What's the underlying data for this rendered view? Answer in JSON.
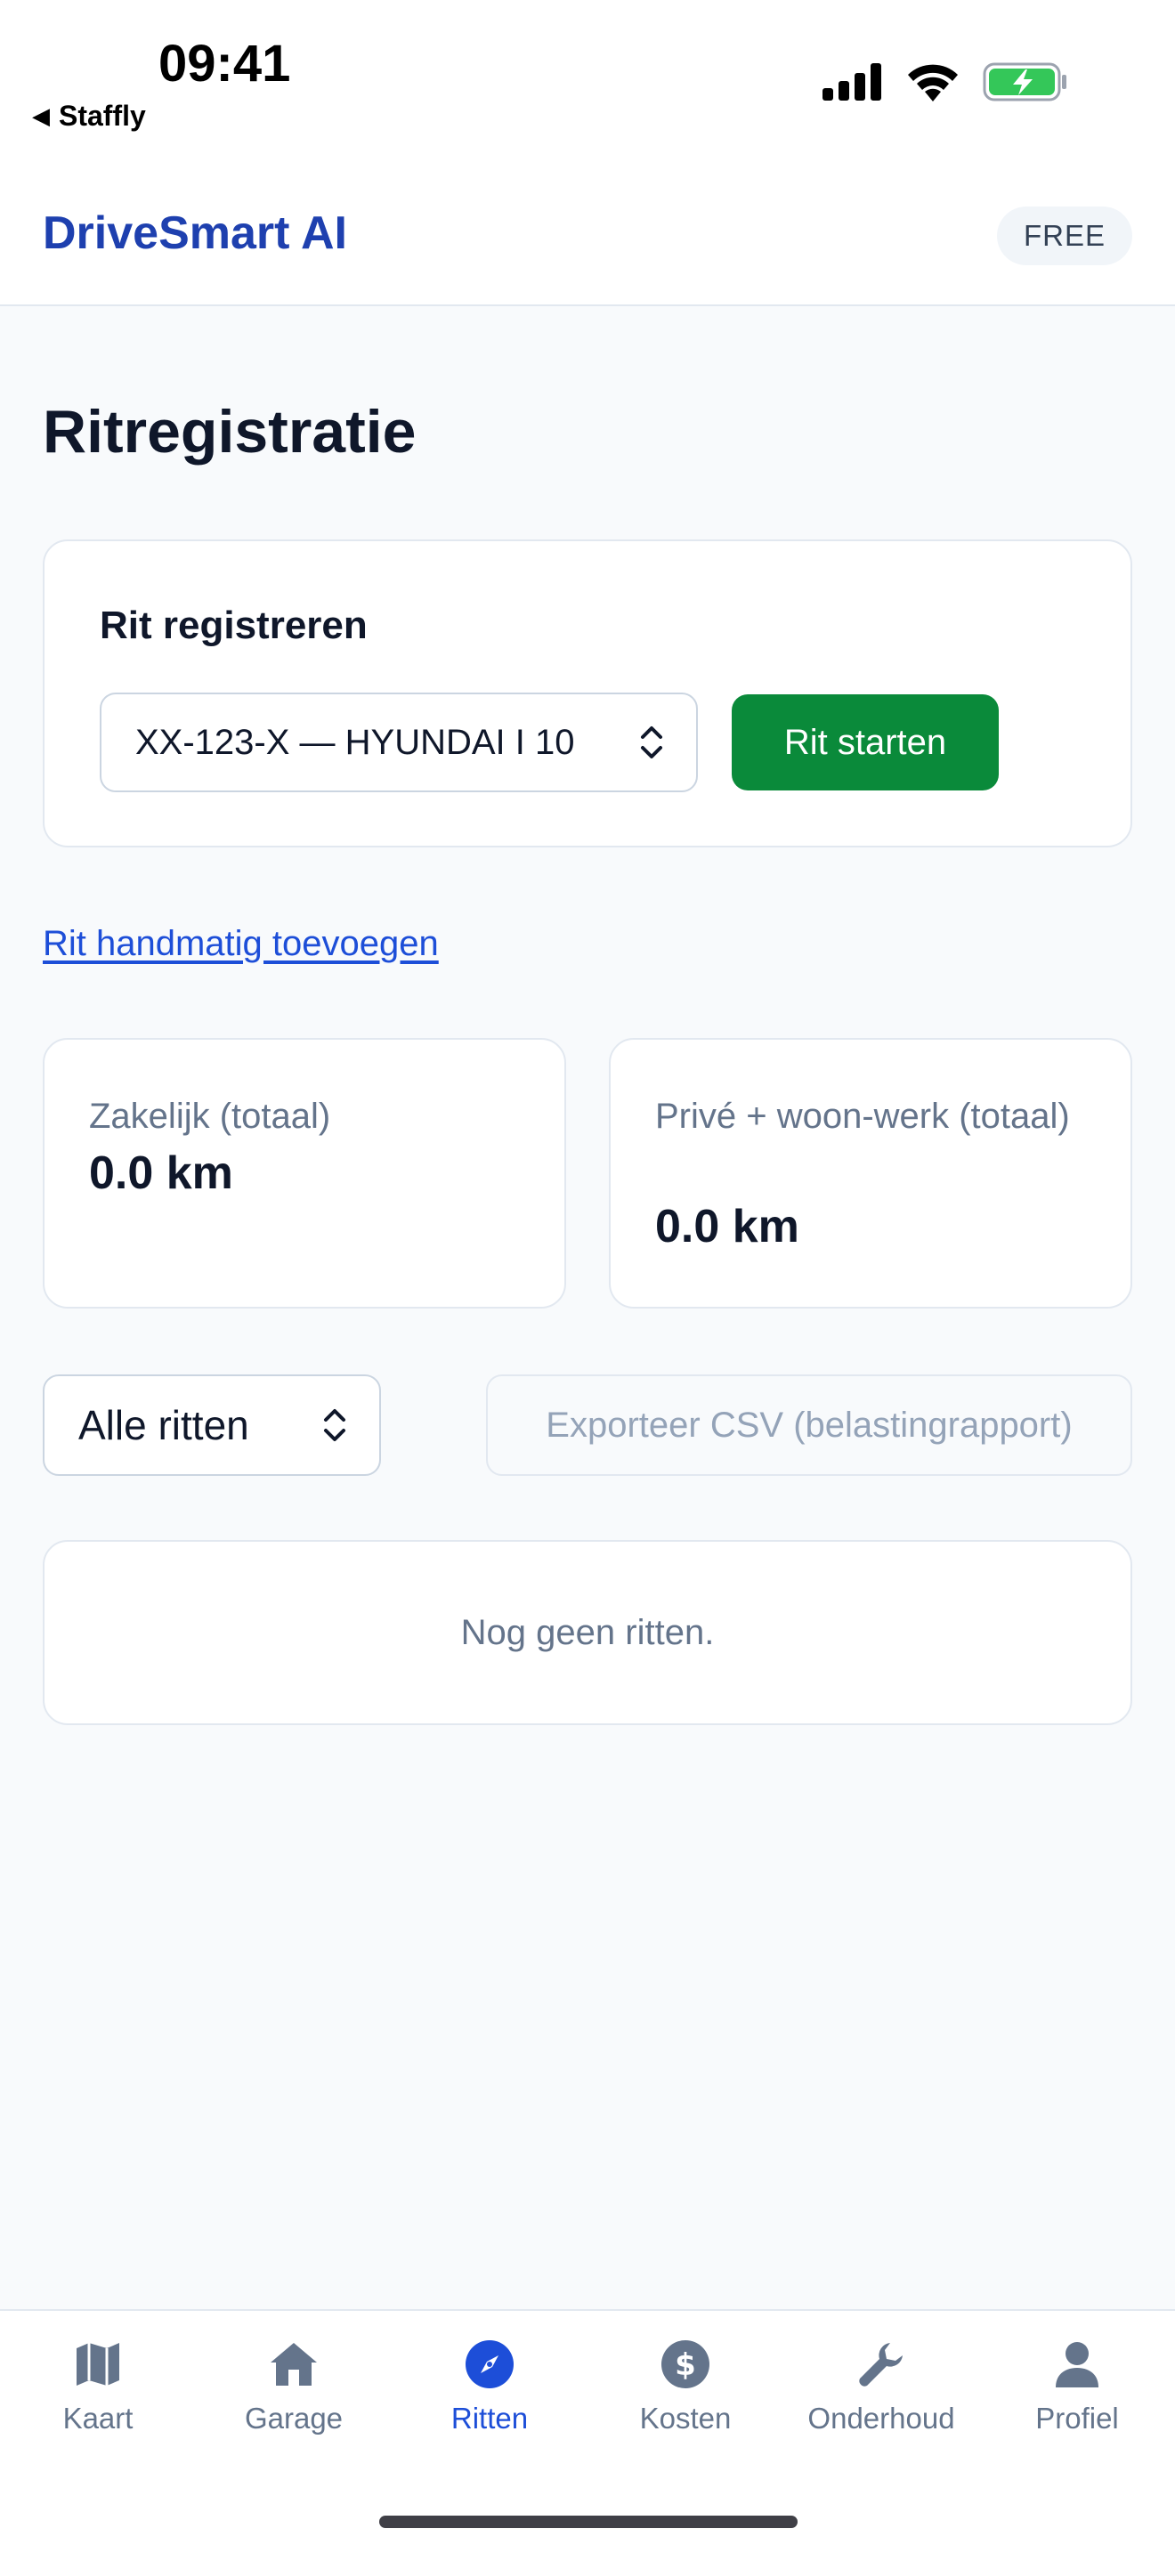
{
  "status_bar": {
    "time": "09:41",
    "back_app": "Staffly",
    "icons": [
      "signal-icon",
      "wifi-icon",
      "battery-charging-icon"
    ]
  },
  "header": {
    "brand": "DriveSmart AI",
    "plan_badge": "FREE"
  },
  "page": {
    "title": "Ritregistratie"
  },
  "registration": {
    "title": "Rit registreren",
    "vehicle_selected": "XX-123-X — HYUNDAI I 10",
    "start_label": "Rit starten"
  },
  "manual_link": "Rit handmatig toevoegen",
  "stats": [
    {
      "label": "Zakelijk (totaal)",
      "value": "0.0 km"
    },
    {
      "label": "Privé + woon-werk (totaal)",
      "value": "0.0 km"
    }
  ],
  "filter": {
    "selected": "Alle ritten"
  },
  "export_label": "Exporteer CSV (belastingrapport)",
  "empty_state": "Nog geen ritten.",
  "tabs": [
    {
      "label": "Kaart",
      "icon": "map-icon",
      "active": false
    },
    {
      "label": "Garage",
      "icon": "home-icon",
      "active": false
    },
    {
      "label": "Ritten",
      "icon": "compass-icon",
      "active": true
    },
    {
      "label": "Kosten",
      "icon": "dollar-icon",
      "active": false
    },
    {
      "label": "Onderhoud",
      "icon": "wrench-icon",
      "active": false
    },
    {
      "label": "Profiel",
      "icon": "person-icon",
      "active": false
    }
  ],
  "colors": {
    "brand": "#1e40af",
    "primary_green": "#0a8a3a",
    "active_tab": "#1d4ed8",
    "inactive_tab": "#64748b",
    "battery_green": "#34c759"
  }
}
